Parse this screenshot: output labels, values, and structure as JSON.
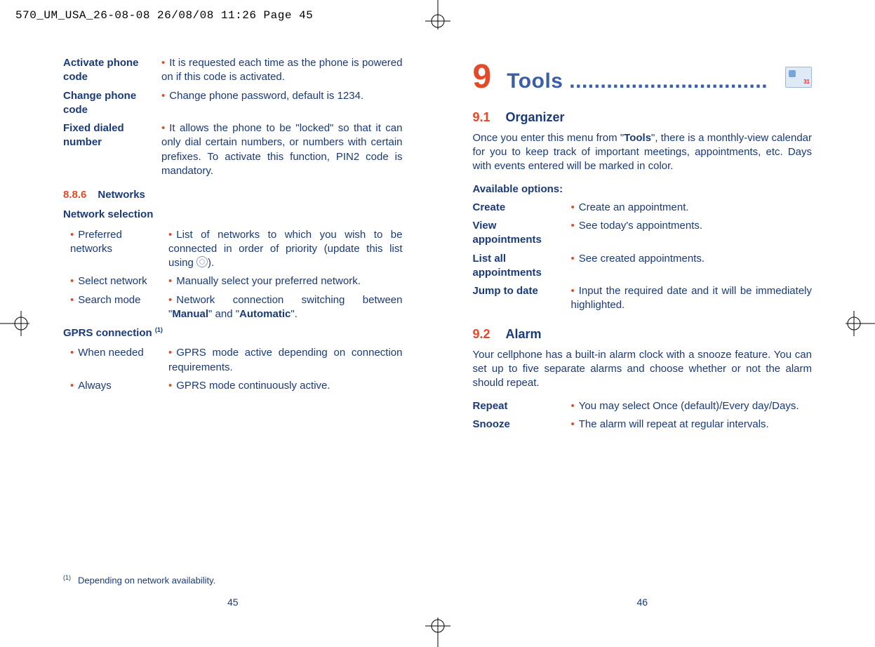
{
  "slug": "570_UM_USA_26-08-08  26/08/08  11:26  Page 45",
  "left": {
    "items": [
      {
        "label": "Activate phone code",
        "desc": "It is requested each time as the phone is powered on if this code is activated."
      },
      {
        "label": "Change phone code",
        "desc": "Change phone password, default is 1234."
      },
      {
        "label": "Fixed dialed number",
        "desc": "It allows the phone to be \"locked\" so that it can only dial certain numbers, or numbers with certain prefixes. To activate this function, PIN2 code is mandatory."
      }
    ],
    "section_num": "8.8.6",
    "section_title": "Networks",
    "netsel_title": "Network selection",
    "netsel": [
      {
        "label": "Preferred networks",
        "desc_pre": "List of networks to which you wish to be connected in order of priority (update this list using ",
        "desc_post": ")."
      },
      {
        "label": "Select network",
        "desc": "Manually select your preferred network."
      },
      {
        "label": "Search mode",
        "desc_pre": "Network connection switching between \"",
        "b1": "Manual",
        "mid": "\" and \"",
        "b2": "Automatic",
        "desc_post": "\"."
      }
    ],
    "gprs_title_pre": "GPRS connection ",
    "gprs_sup": "(1)",
    "gprs": [
      {
        "label": "When needed",
        "desc": "GPRS mode active depending on connection requirements."
      },
      {
        "label": "Always",
        "desc": "GPRS mode continuously active."
      }
    ],
    "footnote_sup": "(1)",
    "footnote_text": "Depending on network availability.",
    "page_number": "45"
  },
  "right": {
    "chapter_num": "9",
    "chapter_title": "Tools ................................",
    "s91_num": "9.1",
    "s91_title": "Organizer",
    "s91_para_pre": "Once you enter this menu from \"",
    "s91_para_bold": "Tools",
    "s91_para_post": "\", there is a monthly-view calendar for you to keep track of important meetings, appointments, etc. Days with events entered will be marked in color.",
    "options_head": "Available options:",
    "options": [
      {
        "label": "Create",
        "desc": "Create an appointment."
      },
      {
        "label": "View appointments",
        "desc": "See today's appointments."
      },
      {
        "label": "List all appointments",
        "desc": "See created appointments."
      },
      {
        "label": "Jump to date",
        "desc": "Input the required date and it will be immediately highlighted."
      }
    ],
    "s92_num": "9.2",
    "s92_title": "Alarm",
    "s92_para": "Your cellphone has a built-in alarm clock with a snooze feature. You can set up to five separate alarms and choose whether or not the alarm should repeat.",
    "alarm_opts": [
      {
        "label": "Repeat",
        "desc": "You may select Once (default)/Every day/Days."
      },
      {
        "label": "Snooze",
        "desc": "The alarm will repeat at regular intervals."
      }
    ],
    "page_number": "46"
  }
}
